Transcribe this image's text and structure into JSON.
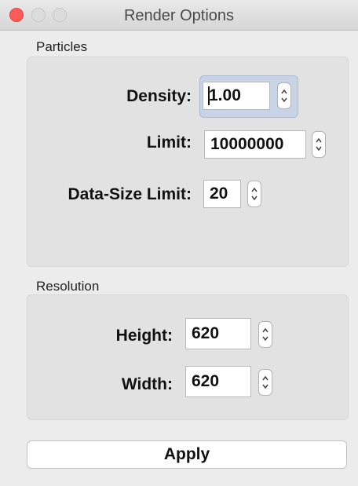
{
  "window": {
    "title": "Render Options"
  },
  "particles": {
    "label": "Particles",
    "density": {
      "label": "Density:",
      "value": "1.00"
    },
    "limit": {
      "label": "Limit:",
      "value": "10000000"
    },
    "data_size_limit": {
      "label": "Data-Size Limit:",
      "value": "20"
    }
  },
  "resolution": {
    "label": "Resolution",
    "height": {
      "label": "Height:",
      "value": "620"
    },
    "width": {
      "label": "Width:",
      "value": "620"
    }
  },
  "apply_label": "Apply",
  "colors": {
    "close": "#fc5b57",
    "focus": "#c8d3e6",
    "group_bg": "#e2e2e2"
  },
  "icons": {
    "stepper": "up-down-arrows-icon"
  }
}
